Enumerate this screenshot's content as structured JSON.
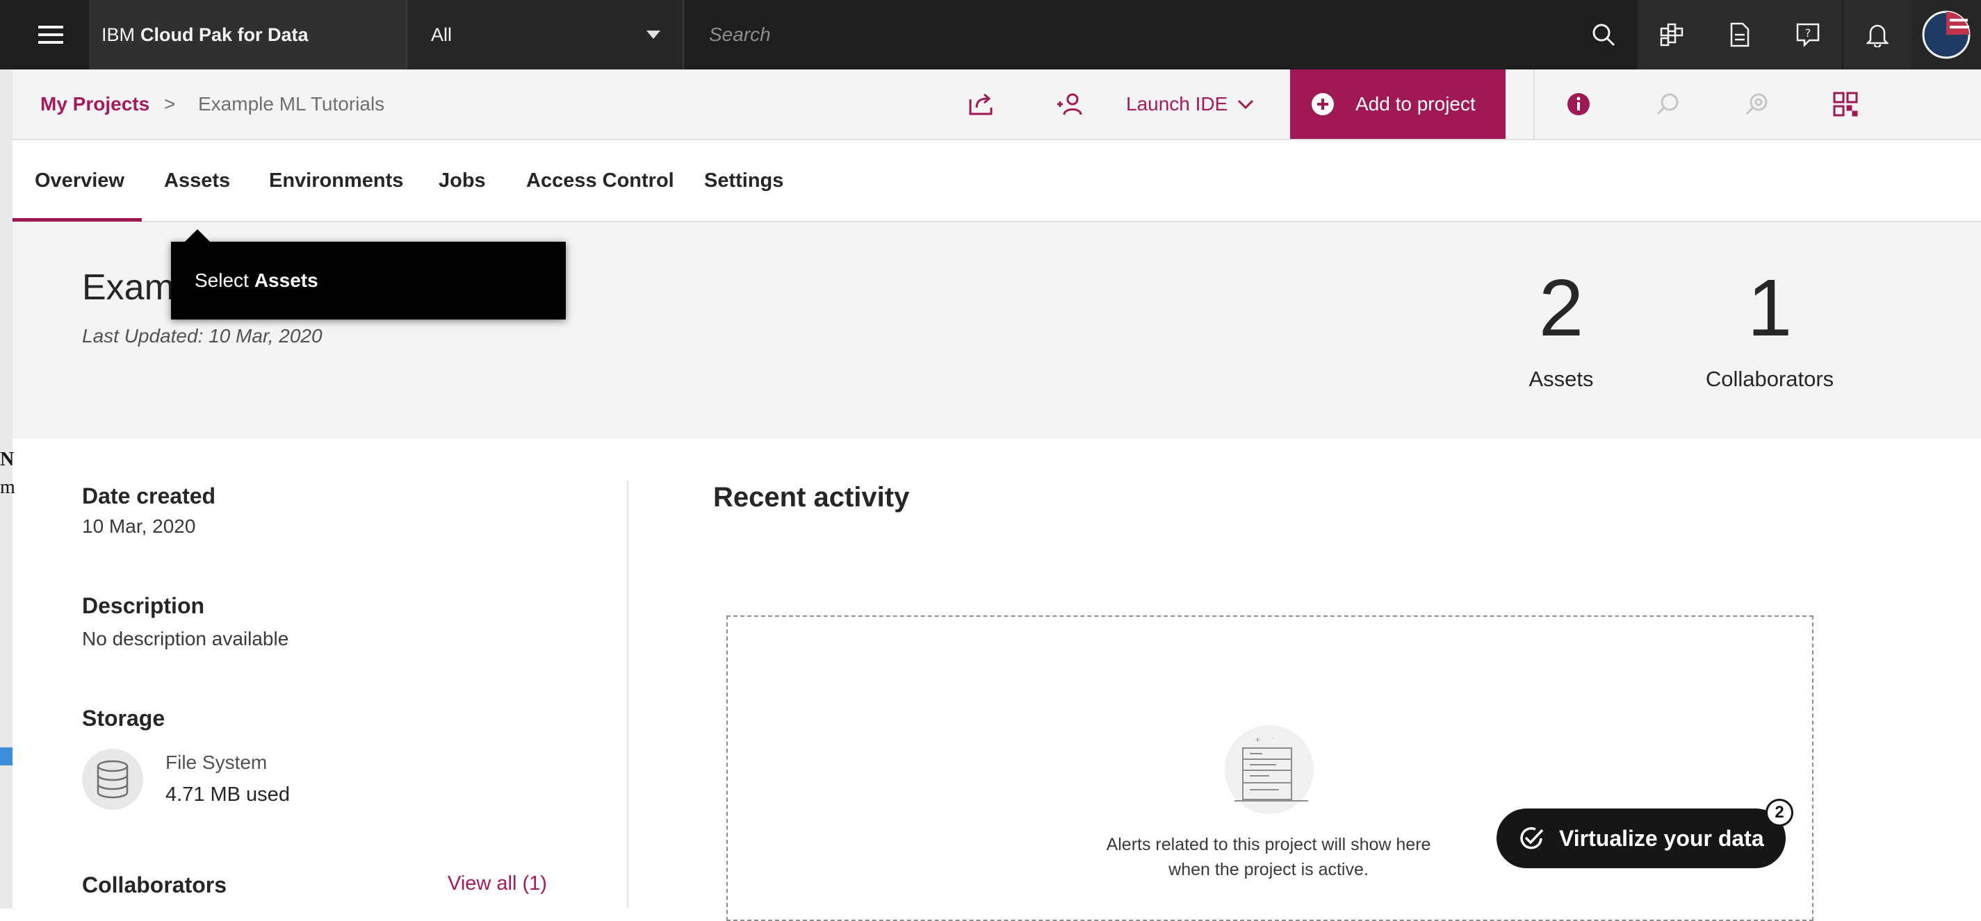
{
  "topbar": {
    "menu_icon": "hamburger-menu-icon",
    "brand_prefix": "IBM",
    "brand_name": "Cloud Pak for Data",
    "scope_value": "All",
    "search_placeholder": "Search",
    "icons": [
      "search-icon",
      "catalog-icon",
      "document-icon",
      "help-icon",
      "notification-icon",
      "avatar-icon"
    ]
  },
  "breadcrumb": {
    "parent": "My Projects",
    "separator": ">",
    "current": "Example ML Tutorials"
  },
  "project_actions": {
    "launch_ide": "Launch IDE",
    "add_to_project": "Add to project"
  },
  "tabs": [
    "Overview",
    "Assets",
    "Environments",
    "Jobs",
    "Access Control",
    "Settings"
  ],
  "tooltip": {
    "prefix": "Select",
    "bold": "Assets"
  },
  "overview": {
    "title_visible": "Exam",
    "last_updated": "Last Updated:  10 Mar, 2020",
    "stats": [
      {
        "value": "2",
        "label": "Assets"
      },
      {
        "value": "1",
        "label": "Collaborators"
      }
    ]
  },
  "details": {
    "date_created_label": "Date created",
    "date_created_value": "10 Mar, 2020",
    "description_label": "Description",
    "description_value": "No description available",
    "storage_label": "Storage",
    "storage_name": "File System",
    "storage_used": "4.71 MB used",
    "collaborators_label": "Collaborators",
    "view_all": "View all (1)"
  },
  "recent_activity": {
    "title": "Recent activity",
    "empty_line1": "Alerts related to this project will show here",
    "empty_line2": "when the project is active."
  },
  "floating": {
    "label": "Virtualize your data",
    "badge": "2"
  },
  "background_window": {
    "edge_text_1": "N",
    "edge_text_2": "m"
  },
  "colors": {
    "accent": "#9f1853",
    "topbar": "#1e1e1e"
  }
}
